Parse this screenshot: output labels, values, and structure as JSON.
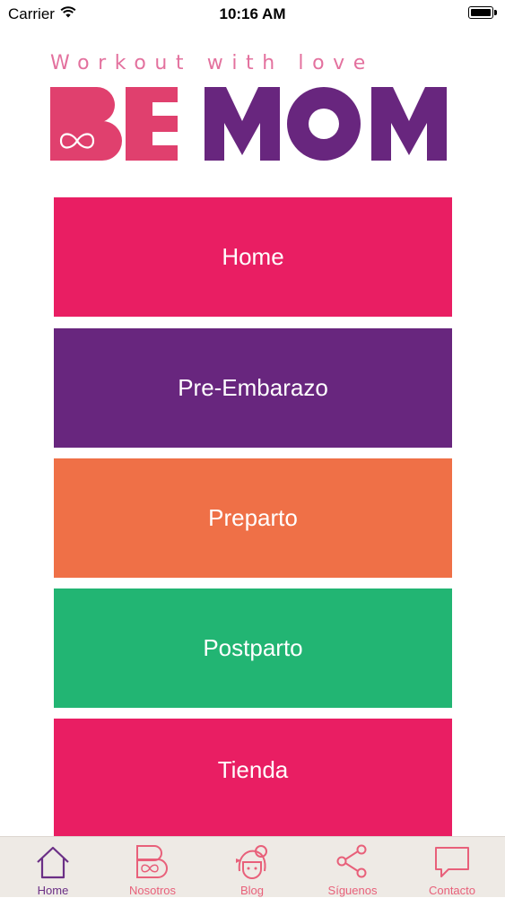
{
  "status_bar": {
    "carrier": "Carrier",
    "time": "10:16 AM"
  },
  "logo": {
    "tagline": "Workout with love",
    "brand": "BE MOM"
  },
  "menu": [
    {
      "label": "Home",
      "color": "#e91e63"
    },
    {
      "label": "Pre-Embarazo",
      "color": "#68267e"
    },
    {
      "label": "Preparto",
      "color": "#ef7047"
    },
    {
      "label": "Postparto",
      "color": "#22b573"
    },
    {
      "label": "Tienda",
      "color": "#e91e63"
    }
  ],
  "tab_bar": {
    "active": "Home",
    "tabs": [
      {
        "label": "Home",
        "icon": "home-icon"
      },
      {
        "label": "Nosotros",
        "icon": "be-logo-icon"
      },
      {
        "label": "Blog",
        "icon": "girl-face-icon"
      },
      {
        "label": "Síguenos",
        "icon": "share-icon"
      },
      {
        "label": "Contacto",
        "icon": "chat-bubble-icon"
      }
    ]
  },
  "colors": {
    "pink": "#e91e63",
    "purple": "#68267e",
    "orange": "#ef7047",
    "green": "#22b573",
    "tab_bar_bg": "#eeeae5",
    "tab_label": "#e8607a"
  }
}
